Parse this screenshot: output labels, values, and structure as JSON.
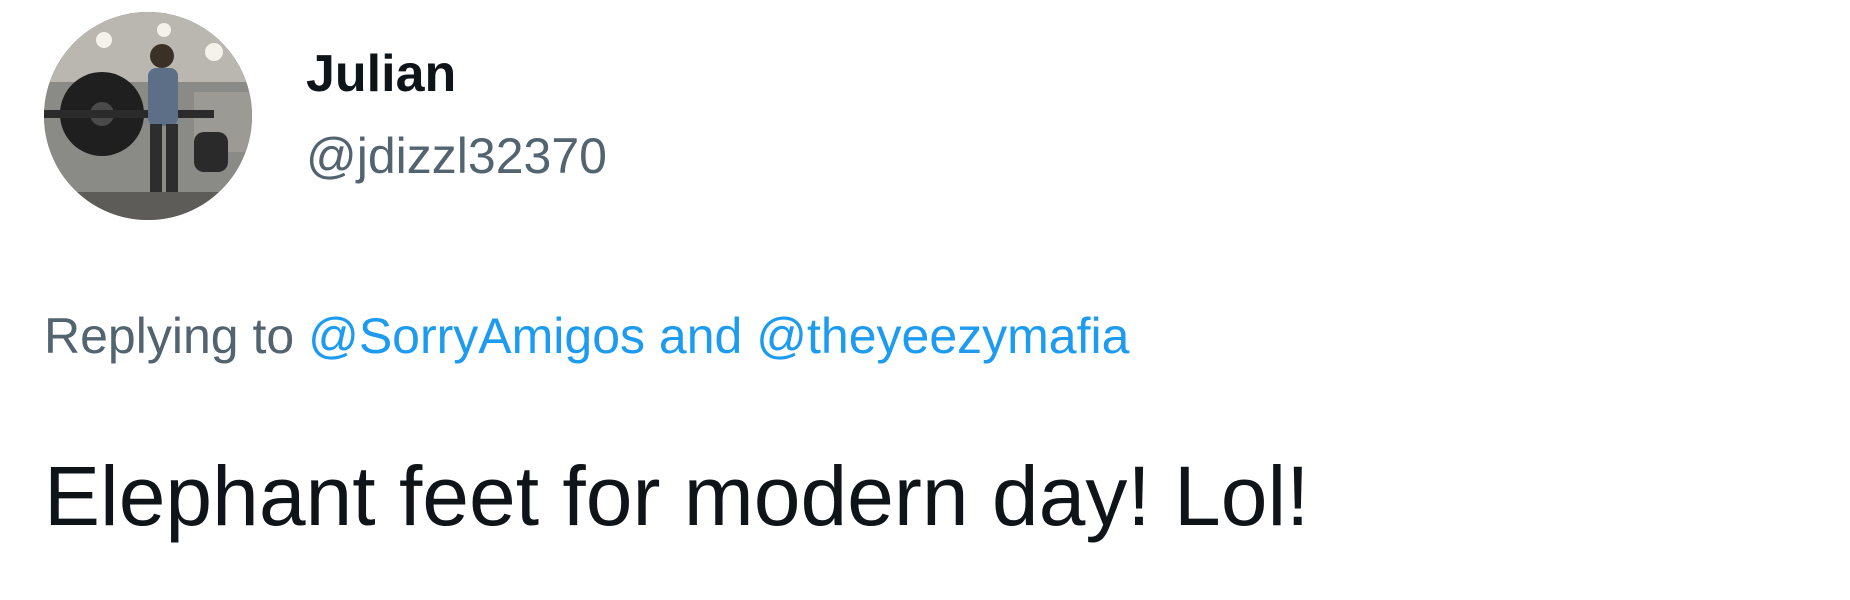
{
  "author": {
    "display_name": "Julian",
    "handle": "@jdizzl32370",
    "avatar_icon": "user-avatar-photo"
  },
  "reply": {
    "prefix": "Replying to",
    "mention_1": "@SorryAmigos",
    "conjunction": "and",
    "mention_2": "@theyeezymafia"
  },
  "tweet": {
    "text": "Elephant feet for modern day! Lol!"
  },
  "colors": {
    "text_primary": "#0f1419",
    "text_secondary": "#536471",
    "link": "#1d9bf0",
    "background": "#ffffff"
  }
}
